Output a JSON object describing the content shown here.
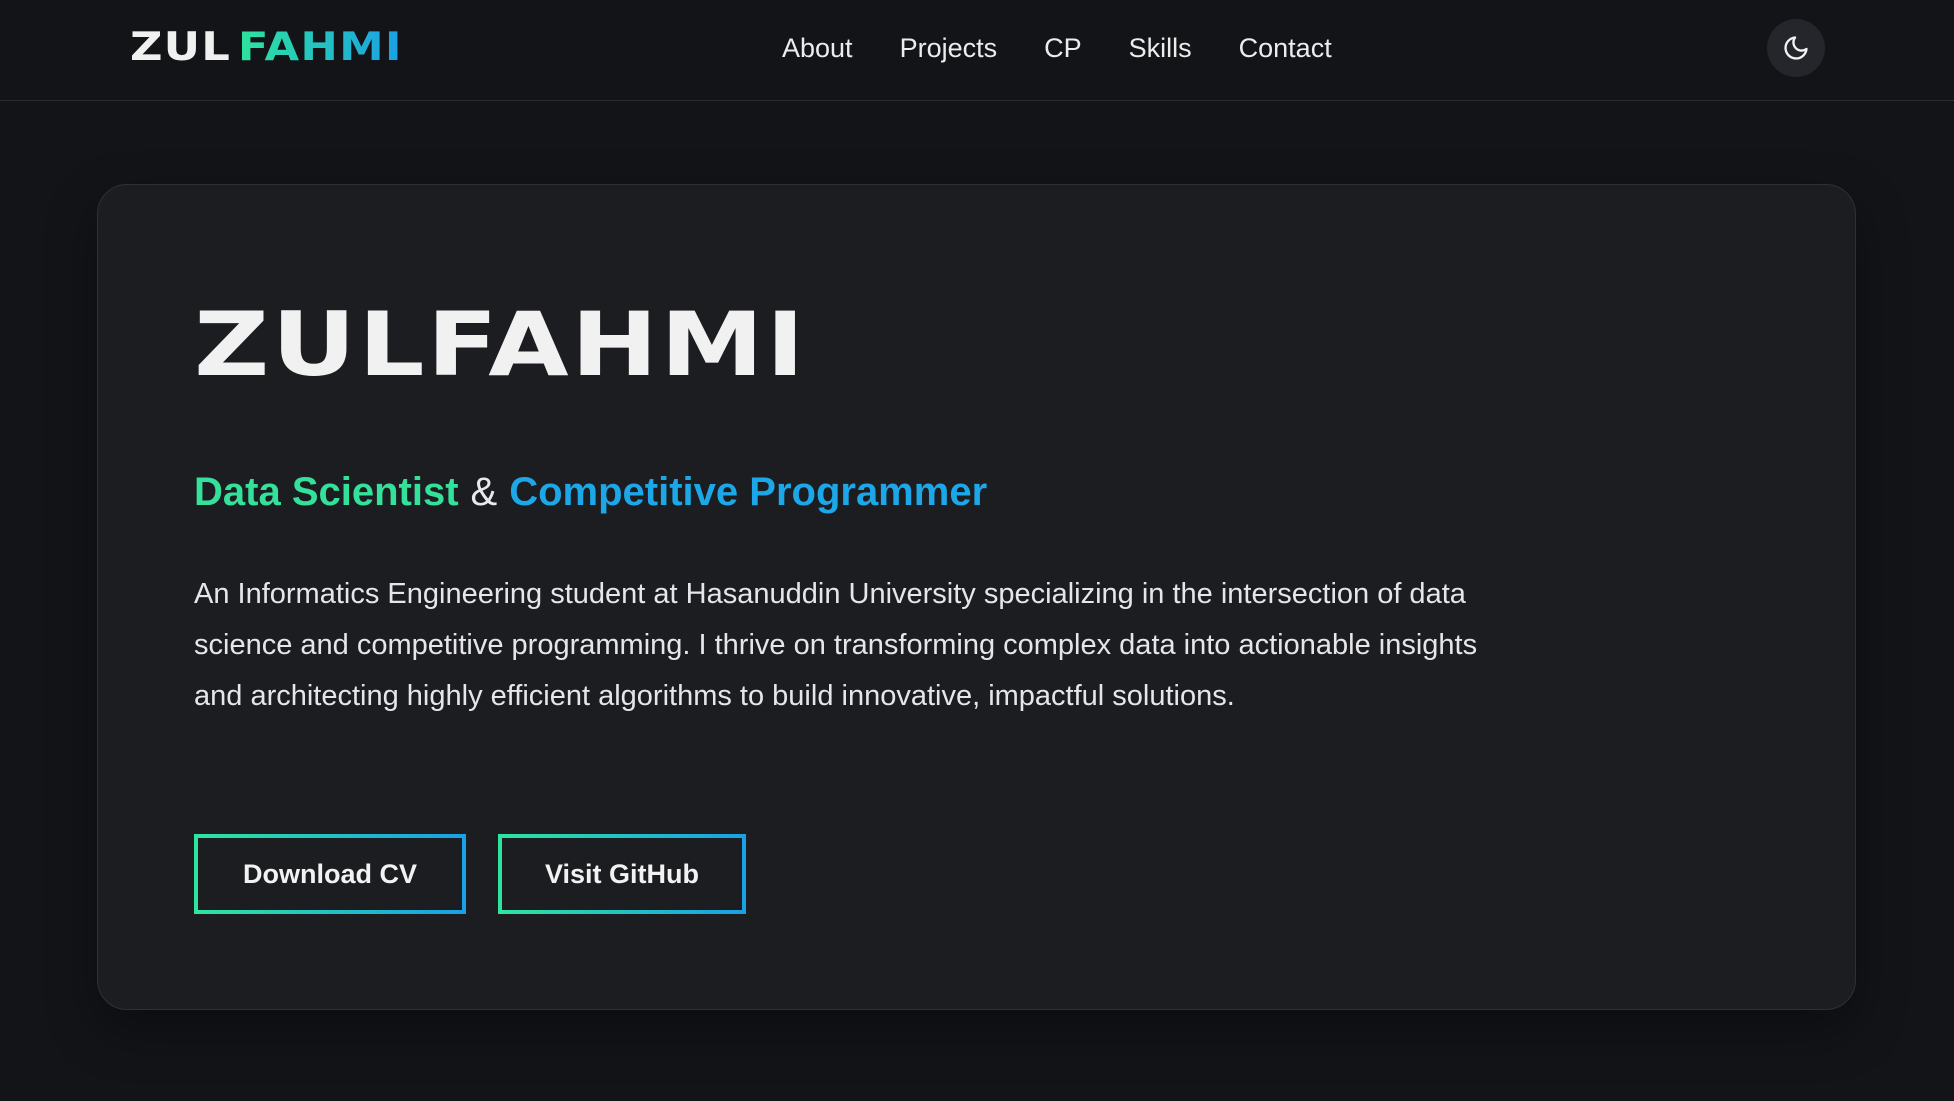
{
  "navbar": {
    "logo_first": "ZUL",
    "logo_last": "FAHMI",
    "links": [
      "About",
      "Projects",
      "CP",
      "Skills",
      "Contact"
    ],
    "theme_toggle_icon": "moon-icon"
  },
  "hero": {
    "title": "ZULFAHMI",
    "role_primary": "Data Scientist",
    "role_separator": "&",
    "role_secondary": "Competitive Programmer",
    "description": "An Informatics Engineering student at Hasanuddin University specializing in the intersection of data science and competitive programming. I thrive on transforming complex data into actionable insights and architecting highly efficient algorithms to build innovative, impactful solutions.",
    "buttons": {
      "download_cv": "Download CV",
      "visit_github": "Visit GitHub"
    }
  },
  "colors": {
    "accent_green": "#2ee59d",
    "accent_blue": "#1a9fe6",
    "background": "#131418",
    "card": "#1c1d21"
  }
}
